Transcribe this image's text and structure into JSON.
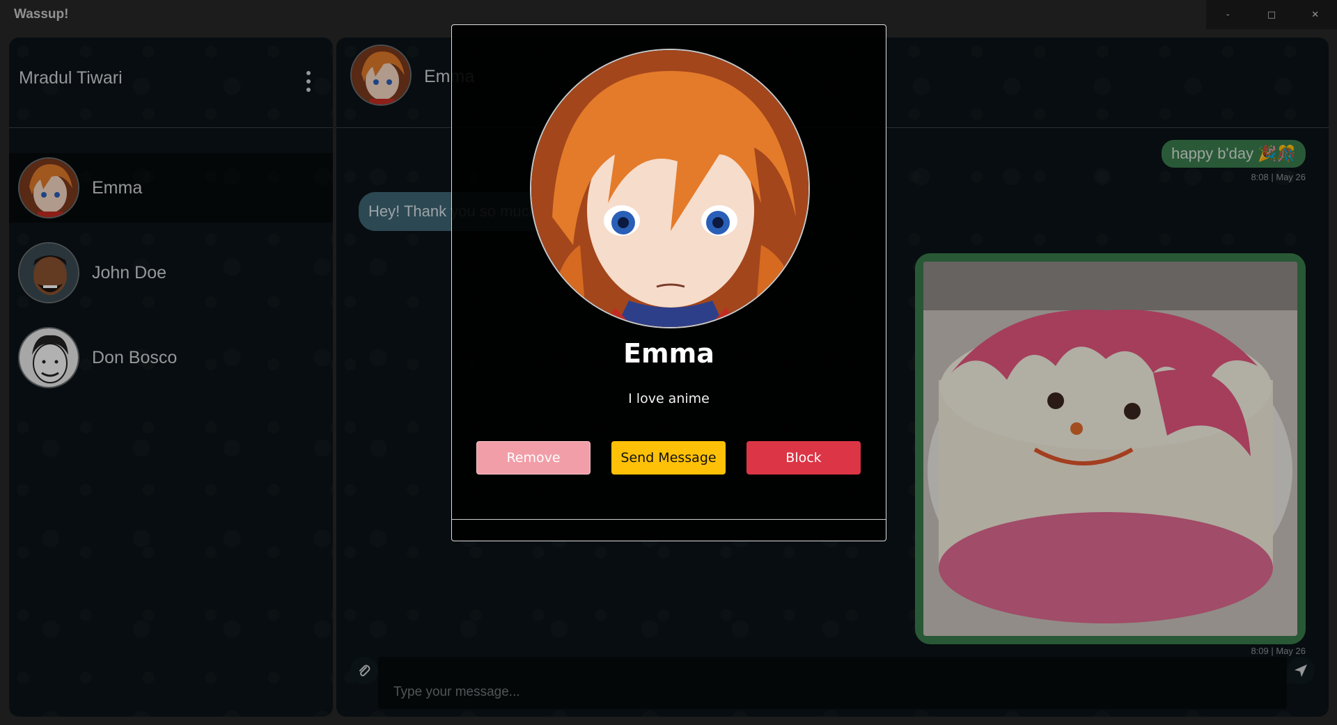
{
  "app": {
    "title": "Wassup!"
  },
  "window_controls": {
    "minimize": "-",
    "maximize": "□",
    "close": "✕"
  },
  "sidebar": {
    "user_name": "Mradul Tiwari",
    "contacts": [
      {
        "name": "Emma",
        "active": true
      },
      {
        "name": "John Doe",
        "active": false
      },
      {
        "name": "Don Bosco",
        "active": false
      }
    ]
  },
  "chat": {
    "contact_name": "Emma",
    "messages": [
      {
        "direction": "outgoing",
        "text": "happy b'day 🎉🎊",
        "time": "8:08 | May 26"
      },
      {
        "direction": "incoming",
        "text": "Hey! Thank you so much"
      },
      {
        "direction": "outgoing",
        "type": "image",
        "image": "birthday-cake",
        "time": "8:09 | May 26"
      }
    ],
    "composer": {
      "placeholder": "Type your message..."
    }
  },
  "profile_modal": {
    "name": "Emma",
    "status": "I love anime",
    "buttons": {
      "remove": "Remove",
      "send_message": "Send Message",
      "block": "Block"
    }
  },
  "colors": {
    "outgoing_bubble": "#3b7c4e",
    "incoming_bubble": "#3e6574",
    "remove": "#f19ea8",
    "send_message": "#ffc107",
    "block": "#dc3545"
  }
}
